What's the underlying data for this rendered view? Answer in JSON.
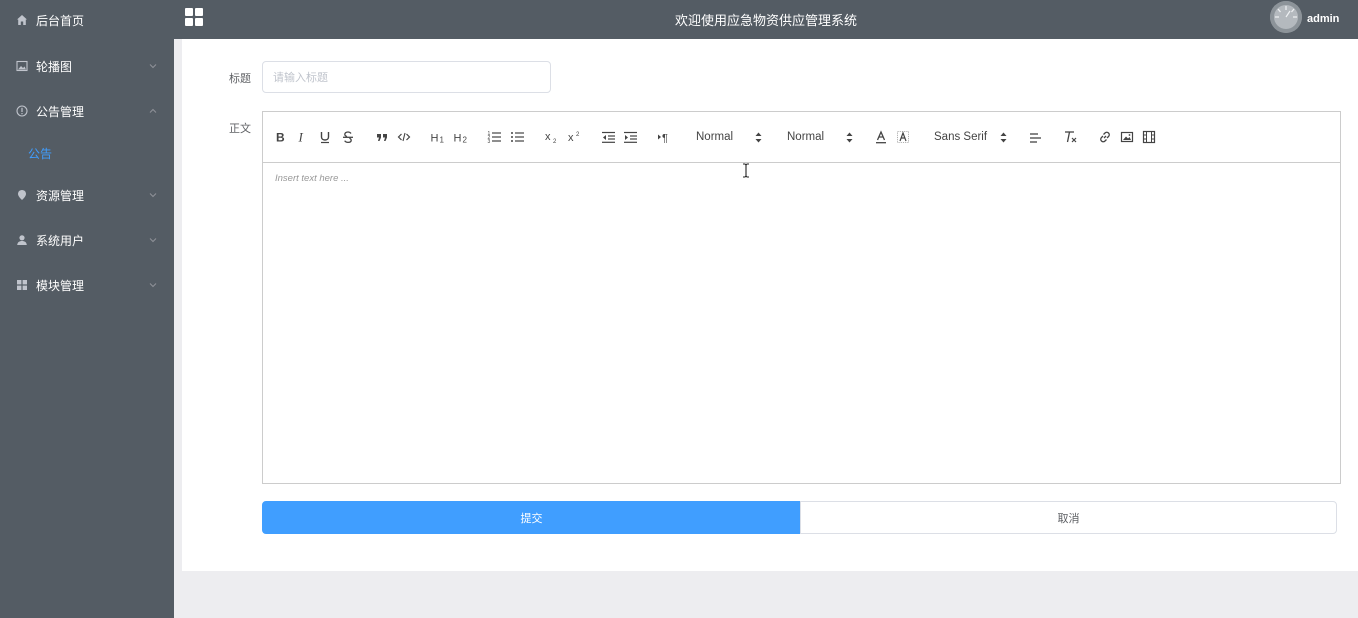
{
  "colors": {
    "sidebar_bg": "#545c64",
    "header_bg": "#545c64",
    "accent": "#409eff",
    "page_bg": "#ededf0"
  },
  "sidebar": {
    "items": [
      {
        "label": "后台首页",
        "icon": "home-icon"
      },
      {
        "label": "轮播图",
        "icon": "picture-icon",
        "expanded": false
      },
      {
        "label": "公告管理",
        "icon": "info-circle-icon",
        "expanded": true
      },
      {
        "label": "资源管理",
        "icon": "location-pin-icon",
        "expanded": false
      },
      {
        "label": "系统用户",
        "icon": "user-icon",
        "expanded": false
      },
      {
        "label": "模块管理",
        "icon": "grid-icon",
        "expanded": false
      }
    ],
    "sub_items": [
      {
        "label": "公告",
        "active": true
      }
    ]
  },
  "header": {
    "title": "欢迎使用应急物资供应管理系统",
    "user": "admin"
  },
  "form": {
    "title_label": "标题",
    "title_placeholder": "请输入标题",
    "body_label": "正文",
    "editor": {
      "placeholder": "Insert text here ...",
      "header_select": "Normal",
      "size_select": "Normal",
      "font_select": "Sans Serif"
    },
    "submit_label": "提交",
    "cancel_label": "取消"
  }
}
